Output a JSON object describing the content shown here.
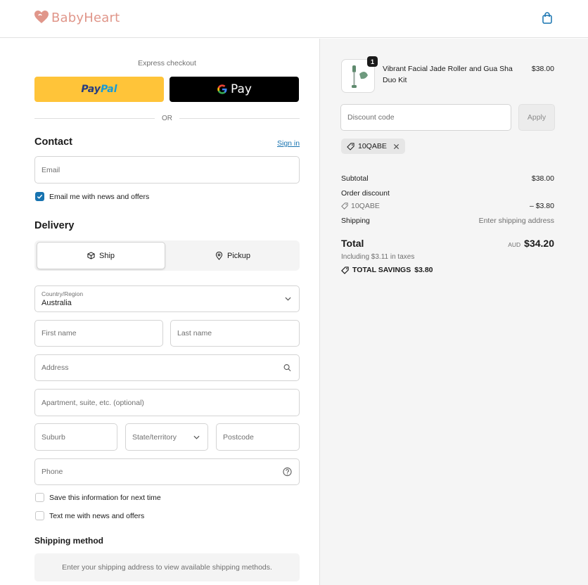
{
  "header": {
    "brand": "BabyHeart",
    "logo_icon": "heart-icon",
    "cart_icon": "shopping-bag-icon",
    "brand_color": "#e0968a"
  },
  "checkout": {
    "express_label": "Express checkout",
    "paypal_label_a": "Pay",
    "paypal_label_b": "Pal",
    "gpay_label": "Pay",
    "or_label": "OR",
    "contact": {
      "heading": "Contact",
      "signin_label": "Sign in",
      "email_placeholder": "Email",
      "news_label": "Email me with news and offers",
      "news_checked": true
    },
    "delivery": {
      "heading": "Delivery",
      "ship_label": "Ship",
      "pickup_label": "Pickup",
      "selected": "Ship",
      "country_label": "Country/Region",
      "country_value": "Australia",
      "first_name_placeholder": "First name",
      "last_name_placeholder": "Last name",
      "address_placeholder": "Address",
      "apartment_placeholder": "Apartment, suite, etc. (optional)",
      "suburb_placeholder": "Suburb",
      "state_placeholder": "State/territory",
      "postcode_placeholder": "Postcode",
      "phone_placeholder": "Phone",
      "save_label": "Save this information for next time",
      "text_label": "Text me with news and offers"
    },
    "shipping_method": {
      "heading": "Shipping method",
      "message": "Enter your shipping address to view available shipping methods."
    }
  },
  "summary": {
    "item": {
      "quantity": "1",
      "name": "Vibrant Facial Jade Roller and Gua Sha Duo Kit",
      "price": "$38.00"
    },
    "discount_placeholder": "Discount code",
    "apply_label": "Apply",
    "applied_code": "10QABE",
    "subtotal_label": "Subtotal",
    "subtotal_value": "$38.00",
    "order_discount_label": "Order discount",
    "discount_code": "10QABE",
    "discount_value": "– $3.80",
    "shipping_label": "Shipping",
    "shipping_value": "Enter shipping address",
    "total_label": "Total",
    "total_currency": "AUD",
    "total_value": "$34.20",
    "taxes_text": "Including $3.11 in taxes",
    "savings_label": "TOTAL SAVINGS",
    "savings_value": "$3.80"
  }
}
